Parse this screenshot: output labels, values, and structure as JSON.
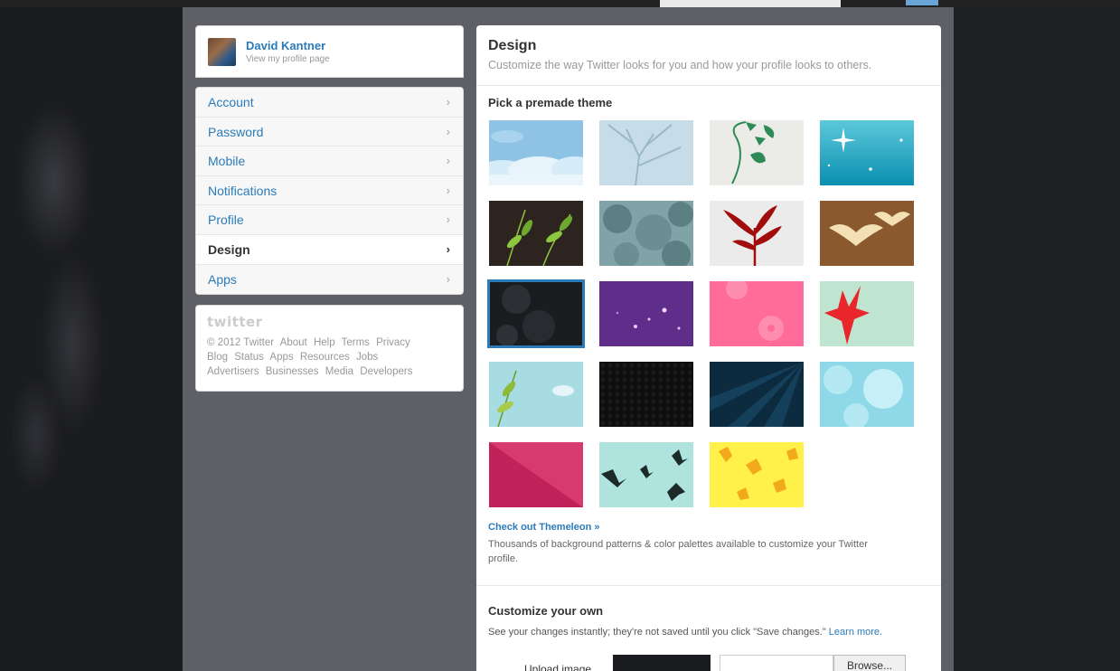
{
  "profile": {
    "name": "David Kantner",
    "subtitle": "View my profile page"
  },
  "nav": {
    "items": [
      {
        "label": "Account",
        "active": false
      },
      {
        "label": "Password",
        "active": false
      },
      {
        "label": "Mobile",
        "active": false
      },
      {
        "label": "Notifications",
        "active": false
      },
      {
        "label": "Profile",
        "active": false
      },
      {
        "label": "Design",
        "active": true
      },
      {
        "label": "Apps",
        "active": false
      }
    ],
    "chevron": "›"
  },
  "footer": {
    "logo": "twitter",
    "copyright": "© 2012 Twitter",
    "links_row1": [
      "About",
      "Help",
      "Terms",
      "Privacy"
    ],
    "links_row2": [
      "Blog",
      "Status",
      "Apps",
      "Resources",
      "Jobs"
    ],
    "links_row3": [
      "Advertisers",
      "Businesses",
      "Media",
      "Developers"
    ]
  },
  "main": {
    "title": "Design",
    "subtitle": "Customize the way Twitter looks for you and how your profile looks to others.",
    "premade_title": "Pick a premade theme",
    "themes": [
      {
        "name": "clouds",
        "colors": [
          "#8ec3e6",
          "#dbeef9"
        ]
      },
      {
        "name": "tree-branches",
        "colors": [
          "#c6dde9",
          "#9ab7c6"
        ]
      },
      {
        "name": "green-vines",
        "colors": [
          "#ebebe7",
          "#2e8a57"
        ]
      },
      {
        "name": "sparkles-teal",
        "colors": [
          "#1aa7c2",
          "#ffffff"
        ]
      },
      {
        "name": "green-leaves-dark",
        "colors": [
          "#2d241f",
          "#8dc63f"
        ]
      },
      {
        "name": "foliage-gray",
        "colors": [
          "#7fa3a6",
          "#5c7f83"
        ]
      },
      {
        "name": "red-plant",
        "colors": [
          "#ebebeb",
          "#a10d0d"
        ]
      },
      {
        "name": "birds-brown",
        "colors": [
          "#8a5a2e",
          "#f3e0b4"
        ]
      },
      {
        "name": "dark-texture",
        "colors": [
          "#1b1c20",
          "#3a3b40"
        ],
        "selected": true
      },
      {
        "name": "purple-sparkle",
        "colors": [
          "#5f2e8a",
          "#c98cf0"
        ]
      },
      {
        "name": "pink-flowers",
        "colors": [
          "#ff6b9a",
          "#ff9cbc"
        ]
      },
      {
        "name": "red-leaf-mint",
        "colors": [
          "#bfe5d1",
          "#e8262b"
        ]
      },
      {
        "name": "leaves-mint",
        "colors": [
          "#a7dce2",
          "#8dba3a"
        ]
      },
      {
        "name": "hex-black",
        "colors": [
          "#0d0d0d",
          "#222222"
        ]
      },
      {
        "name": "rays-navy",
        "colors": [
          "#0d2b3f",
          "#15405c"
        ]
      },
      {
        "name": "bokeh-cyan",
        "colors": [
          "#8fd8e8",
          "#c6eff7"
        ]
      },
      {
        "name": "magenta-diagonal",
        "colors": [
          "#c2215a",
          "#d63a6e"
        ]
      },
      {
        "name": "birds-mint",
        "colors": [
          "#aee4dd",
          "#1d2b28"
        ]
      },
      {
        "name": "yellow-leaves",
        "colors": [
          "#fff04a",
          "#f2a91c"
        ]
      }
    ],
    "themeleon_link": "Check out Themeleon »",
    "themeleon_desc": "Thousands of background patterns & color palettes available to customize your Twitter profile.",
    "custom_title": "Customize your own",
    "custom_desc": "See your changes instantly; they're not saved until you click \"Save changes.\"",
    "learn_more": "Learn more.",
    "upload_label": "Upload image",
    "browse_label": "Browse..."
  },
  "colors": {
    "link": "#2b7bb9",
    "page_bg": "#1b1c20",
    "container_bg": "#5f6066",
    "selected_outline": "#2b7bb9"
  }
}
